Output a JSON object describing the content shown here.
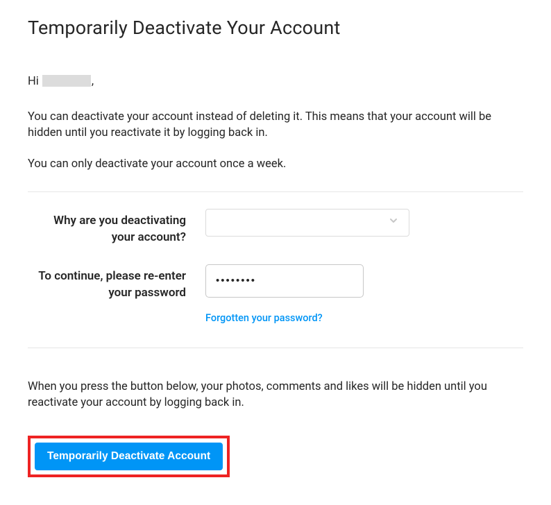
{
  "title": "Temporarily Deactivate Your Account",
  "greeting_prefix": "Hi ",
  "greeting_suffix": ",",
  "intro_paragraph_1": "You can deactivate your account instead of deleting it. This means that your account will be hidden until you reactivate it by logging back in.",
  "intro_paragraph_2": "You can only deactivate your account once a week.",
  "form": {
    "reason_label": "Why are you deactivating your account?",
    "reason_selected": "",
    "password_label": "To continue, please re-enter your password",
    "password_value": "••••••••",
    "forgot_link": "Forgotten your password?"
  },
  "outro_paragraph": "When you press the button below, your photos, comments and likes will be hidden until you reactivate your account by logging back in.",
  "submit_button": "Temporarily Deactivate Account"
}
